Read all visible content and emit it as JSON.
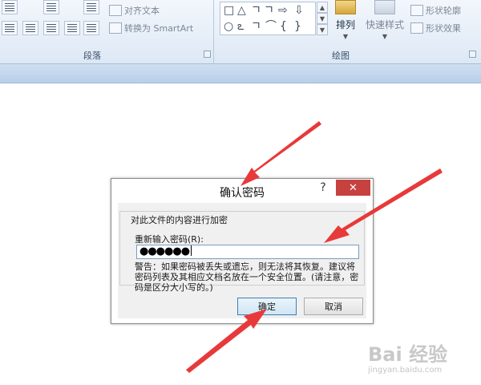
{
  "ribbon": {
    "align_text_label": "对齐文本",
    "convert_smartart_label": "转换为 SmartArt",
    "paragraph_group_label": "段落",
    "drawing_group_label": "绘图",
    "arrange_label": "排列",
    "quick_styles_label": "快速样式",
    "shape_outline_label": "形状轮廓",
    "shape_effects_label": "形状效果",
    "shape_glyphs_row1": [
      "□",
      "▷",
      "△",
      "ㄱ",
      "ㄱ",
      "⇨",
      "⇩"
    ],
    "shape_glyphs_row2": [
      "○",
      "ఽ",
      "ㄱ",
      "⌒",
      "{",
      "}",
      "☆"
    ],
    "icons": [
      "dropdown-arrow-icon",
      "dialog-launcher-icon",
      "shape-outline-icon",
      "shape-effects-icon"
    ]
  },
  "dialog": {
    "title": "确认密码",
    "help": "?",
    "close": "✕",
    "group_label": "对此文件的内容进行加密",
    "prompt": "重新输入密码(R):",
    "password_mask": "●●●●●●",
    "warning": "警告：如果密码被丢失或遗忘，则无法将其恢复。建议将密码列表及其相应文档名放在一个安全位置。(请注意，密码是区分大小写的。)",
    "ok_label": "确定",
    "cancel_label": "取消"
  },
  "watermark": {
    "logo": "Bai 经验",
    "logo_suffix": "经验",
    "url": "jingyan.baidu.com"
  },
  "colors": {
    "close_button": "#c7413f",
    "annotation_arrow": "#e8393a",
    "ribbon_bg": "#dde8f5"
  }
}
